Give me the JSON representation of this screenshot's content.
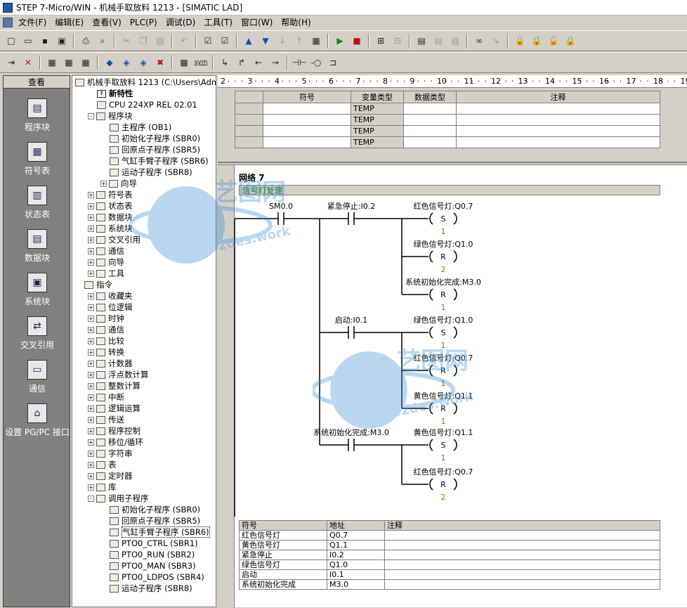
{
  "window": {
    "title": "STEP 7-Micro/WIN - 机械手取放料 1213 - [SIMATIC LAD]"
  },
  "menu": [
    "文件(F)",
    "编辑(E)",
    "查看(V)",
    "PLC(P)",
    "调试(D)",
    "工具(T)",
    "窗口(W)",
    "帮助(H)"
  ],
  "toolbar2_text": {
    "sym": "sym"
  },
  "nav": {
    "header": "查看",
    "items": [
      {
        "label": "程序块",
        "icon": "program-block-icon"
      },
      {
        "label": "符号表",
        "icon": "symbol-table-icon"
      },
      {
        "label": "状态表",
        "icon": "status-table-icon"
      },
      {
        "label": "数据块",
        "icon": "data-block-icon"
      },
      {
        "label": "系统块",
        "icon": "system-block-icon"
      },
      {
        "label": "交叉引用",
        "icon": "cross-reference-icon"
      },
      {
        "label": "通信",
        "icon": "communication-icon"
      },
      {
        "label": "设置 PG/PC 接口",
        "icon": "pg-pc-interface-icon"
      }
    ]
  },
  "tree": {
    "project": "机械手取放料 1213 (C:\\Users\\Admir",
    "rows": [
      {
        "label": "新特性",
        "indent": 1,
        "exp": "",
        "icon": "?"
      },
      {
        "label": "CPU 224XP REL 02.01",
        "indent": 1,
        "exp": "",
        "icon": "cpu"
      },
      {
        "label": "程序块",
        "indent": 1,
        "exp": "-",
        "icon": "blk"
      },
      {
        "label": "主程序 (OB1)",
        "indent": 2,
        "exp": "",
        "icon": "pg"
      },
      {
        "label": "初始化子程序 (SBR0)",
        "indent": 2,
        "exp": "",
        "icon": "pg"
      },
      {
        "label": "回原点子程序 (SBR5)",
        "indent": 2,
        "exp": "",
        "icon": "pg"
      },
      {
        "label": "气缸手臂子程序 (SBR6)",
        "indent": 2,
        "exp": "",
        "icon": "pg"
      },
      {
        "label": "运动子程序 (SBR8)",
        "indent": 2,
        "exp": "",
        "icon": "pg"
      },
      {
        "label": "向导",
        "indent": 2,
        "exp": "+",
        "icon": "wz"
      },
      {
        "label": "符号表",
        "indent": 1,
        "exp": "+",
        "icon": "tb"
      },
      {
        "label": "状态表",
        "indent": 1,
        "exp": "+",
        "icon": "tb"
      },
      {
        "label": "数据块",
        "indent": 1,
        "exp": "+",
        "icon": "tb"
      },
      {
        "label": "系统块",
        "indent": 1,
        "exp": "+",
        "icon": "tb"
      },
      {
        "label": "交叉引用",
        "indent": 1,
        "exp": "+",
        "icon": "tb"
      },
      {
        "label": "通信",
        "indent": 1,
        "exp": "+",
        "icon": "tb"
      },
      {
        "label": "向导",
        "indent": 1,
        "exp": "+",
        "icon": "wz"
      },
      {
        "label": "工具",
        "indent": 1,
        "exp": "+",
        "icon": "tl"
      },
      {
        "label": "指令",
        "indent": 0,
        "exp": "",
        "icon": "in"
      },
      {
        "label": "收藏夹",
        "indent": 1,
        "exp": "+",
        "icon": "f"
      },
      {
        "label": "位逻辑",
        "indent": 1,
        "exp": "+",
        "icon": "f"
      },
      {
        "label": "时钟",
        "indent": 1,
        "exp": "+",
        "icon": "f"
      },
      {
        "label": "通信",
        "indent": 1,
        "exp": "+",
        "icon": "f"
      },
      {
        "label": "比较",
        "indent": 1,
        "exp": "+",
        "icon": "f"
      },
      {
        "label": "转换",
        "indent": 1,
        "exp": "+",
        "icon": "f"
      },
      {
        "label": "计数器",
        "indent": 1,
        "exp": "+",
        "icon": "f"
      },
      {
        "label": "浮点数计算",
        "indent": 1,
        "exp": "+",
        "icon": "f"
      },
      {
        "label": "整数计算",
        "indent": 1,
        "exp": "+",
        "icon": "f"
      },
      {
        "label": "中断",
        "indent": 1,
        "exp": "+",
        "icon": "f"
      },
      {
        "label": "逻辑运算",
        "indent": 1,
        "exp": "+",
        "icon": "f"
      },
      {
        "label": "传送",
        "indent": 1,
        "exp": "+",
        "icon": "f"
      },
      {
        "label": "程序控制",
        "indent": 1,
        "exp": "+",
        "icon": "f"
      },
      {
        "label": "移位/循环",
        "indent": 1,
        "exp": "+",
        "icon": "f"
      },
      {
        "label": "字符串",
        "indent": 1,
        "exp": "+",
        "icon": "f"
      },
      {
        "label": "表",
        "indent": 1,
        "exp": "+",
        "icon": "f"
      },
      {
        "label": "定时器",
        "indent": 1,
        "exp": "+",
        "icon": "f"
      },
      {
        "label": "库",
        "indent": 1,
        "exp": "+",
        "icon": "f"
      },
      {
        "label": "调用子程序",
        "indent": 1,
        "exp": "-",
        "icon": "blk"
      },
      {
        "label": "初始化子程序 (SBR0)",
        "indent": 2,
        "exp": "",
        "icon": "pg"
      },
      {
        "label": "回原点子程序 (SBR5)",
        "indent": 2,
        "exp": "",
        "icon": "pg"
      },
      {
        "label": "气缸手臂子程序 (SBR6)",
        "indent": 2,
        "exp": "",
        "icon": "pg",
        "selected": true
      },
      {
        "label": "PTO0_CTRL (SBR1)",
        "indent": 2,
        "exp": "",
        "icon": "lk"
      },
      {
        "label": "PTO0_RUN (SBR2)",
        "indent": 2,
        "exp": "",
        "icon": "lk"
      },
      {
        "label": "PTO0_MAN (SBR3)",
        "indent": 2,
        "exp": "",
        "icon": "lk"
      },
      {
        "label": "PTO0_LDPOS (SBR4)",
        "indent": 2,
        "exp": "",
        "icon": "lk"
      },
      {
        "label": "运动子程序 (SBR8)",
        "indent": 2,
        "exp": "",
        "icon": "pg"
      }
    ]
  },
  "ruler": {
    "ticks": [
      "2",
      "3",
      "4",
      "5",
      "6",
      "7",
      "8",
      "9",
      "10",
      "11",
      "12",
      "13",
      "14",
      "15",
      "16",
      "17",
      "18",
      "19"
    ]
  },
  "var_table": {
    "headers": [
      "符号",
      "变量类型",
      "数据类型",
      "注释"
    ],
    "rows": [
      [
        "",
        "TEMP",
        "",
        ""
      ],
      [
        "",
        "TEMP",
        "",
        ""
      ],
      [
        "",
        "TEMP",
        "",
        ""
      ],
      [
        "",
        "TEMP",
        "",
        ""
      ]
    ]
  },
  "network": {
    "label": "网络 7",
    "comment": "信号灯处理",
    "contacts": [
      {
        "text": "SM0.0"
      },
      {
        "text": "紧急停止:I0.2"
      },
      {
        "text": "启动:I0.1"
      },
      {
        "text": "系统初始化完成:M3.0"
      }
    ],
    "coils": [
      {
        "addr": "红色信号灯:Q0.7",
        "op": "S",
        "n": "1"
      },
      {
        "addr": "绿色信号灯:Q1.0",
        "op": "R",
        "n": "2"
      },
      {
        "addr": "系统初始化完成:M3.0",
        "op": "R",
        "n": "1"
      },
      {
        "addr": "绿色信号灯:Q1.0",
        "op": "S",
        "n": "1"
      },
      {
        "addr": "红色信号灯:Q0.7",
        "op": "R",
        "n": "1"
      },
      {
        "addr": "黄色信号灯:Q1.1",
        "op": "R",
        "n": "1"
      },
      {
        "addr": "黄色信号灯:Q1.1",
        "op": "S",
        "n": "1"
      },
      {
        "addr": "红色信号灯:Q0.7",
        "op": "R",
        "n": "2"
      }
    ]
  },
  "symbol_table": {
    "headers": [
      "符号",
      "地址",
      "注释"
    ],
    "rows": [
      [
        "红色信号灯",
        "Q0.7",
        ""
      ],
      [
        "黄色信号灯",
        "Q1.1",
        ""
      ],
      [
        "紧急停止",
        "I0.2",
        ""
      ],
      [
        "绿色信号灯",
        "Q1.0",
        ""
      ],
      [
        "启动",
        "I0.1",
        ""
      ],
      [
        "系统初始化完成",
        "M3.0",
        ""
      ]
    ]
  },
  "watermark": {
    "text1": "艺图网",
    "text2": "www.52des.work"
  }
}
